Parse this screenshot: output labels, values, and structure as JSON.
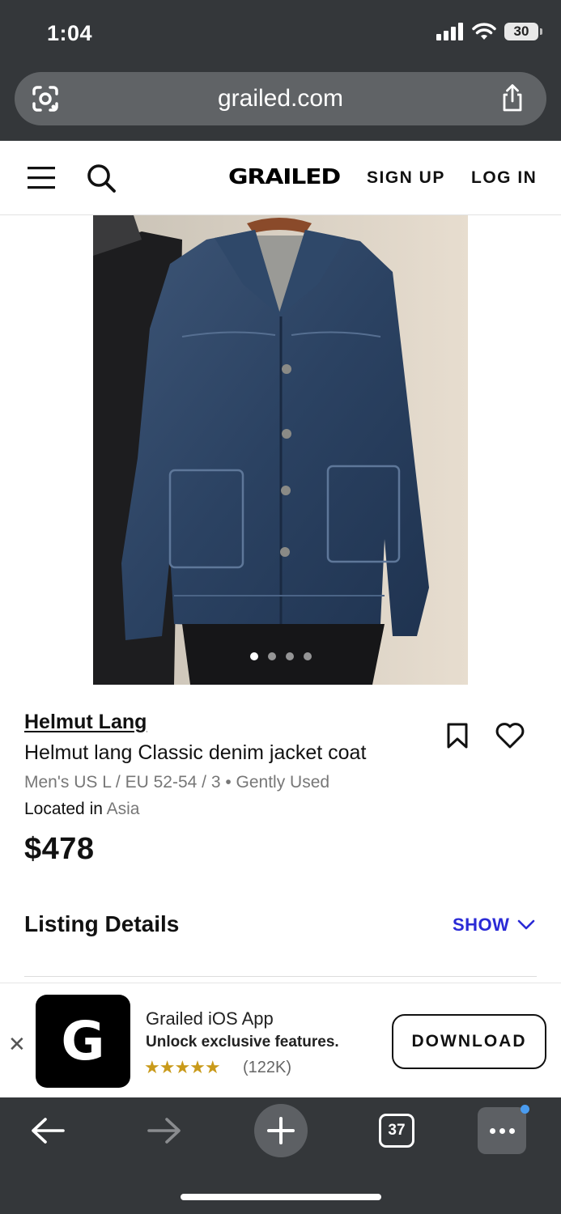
{
  "status_bar": {
    "time": "1:04",
    "battery": "30"
  },
  "browser": {
    "url": "grailed.com"
  },
  "header": {
    "logo": "GRAILED",
    "signup": "SIGN UP",
    "login": "LOG IN"
  },
  "gallery": {
    "total_images": 4,
    "active_index": 0
  },
  "listing": {
    "brand": "Helmut Lang",
    "title": "Helmut lang Classic denim jacket coat",
    "size_condition": "Men's US L / EU 52-54 / 3 • Gently Used",
    "location_label": "Located in ",
    "location_value": "Asia",
    "price": "$478"
  },
  "details": {
    "heading": "Listing Details",
    "toggle": "SHOW"
  },
  "app_banner": {
    "close": "✕",
    "app_icon_letter": "G",
    "title": "Grailed iOS App",
    "subtitle": "Unlock exclusive features.",
    "stars": "★★★★★",
    "rating_count": "(122K)",
    "button": "DOWNLOAD"
  },
  "toolbar": {
    "tab_count": "37"
  },
  "colors": {
    "chrome": "#34373a",
    "accent_blue": "#2a2ad6",
    "star": "#c99a1a"
  }
}
